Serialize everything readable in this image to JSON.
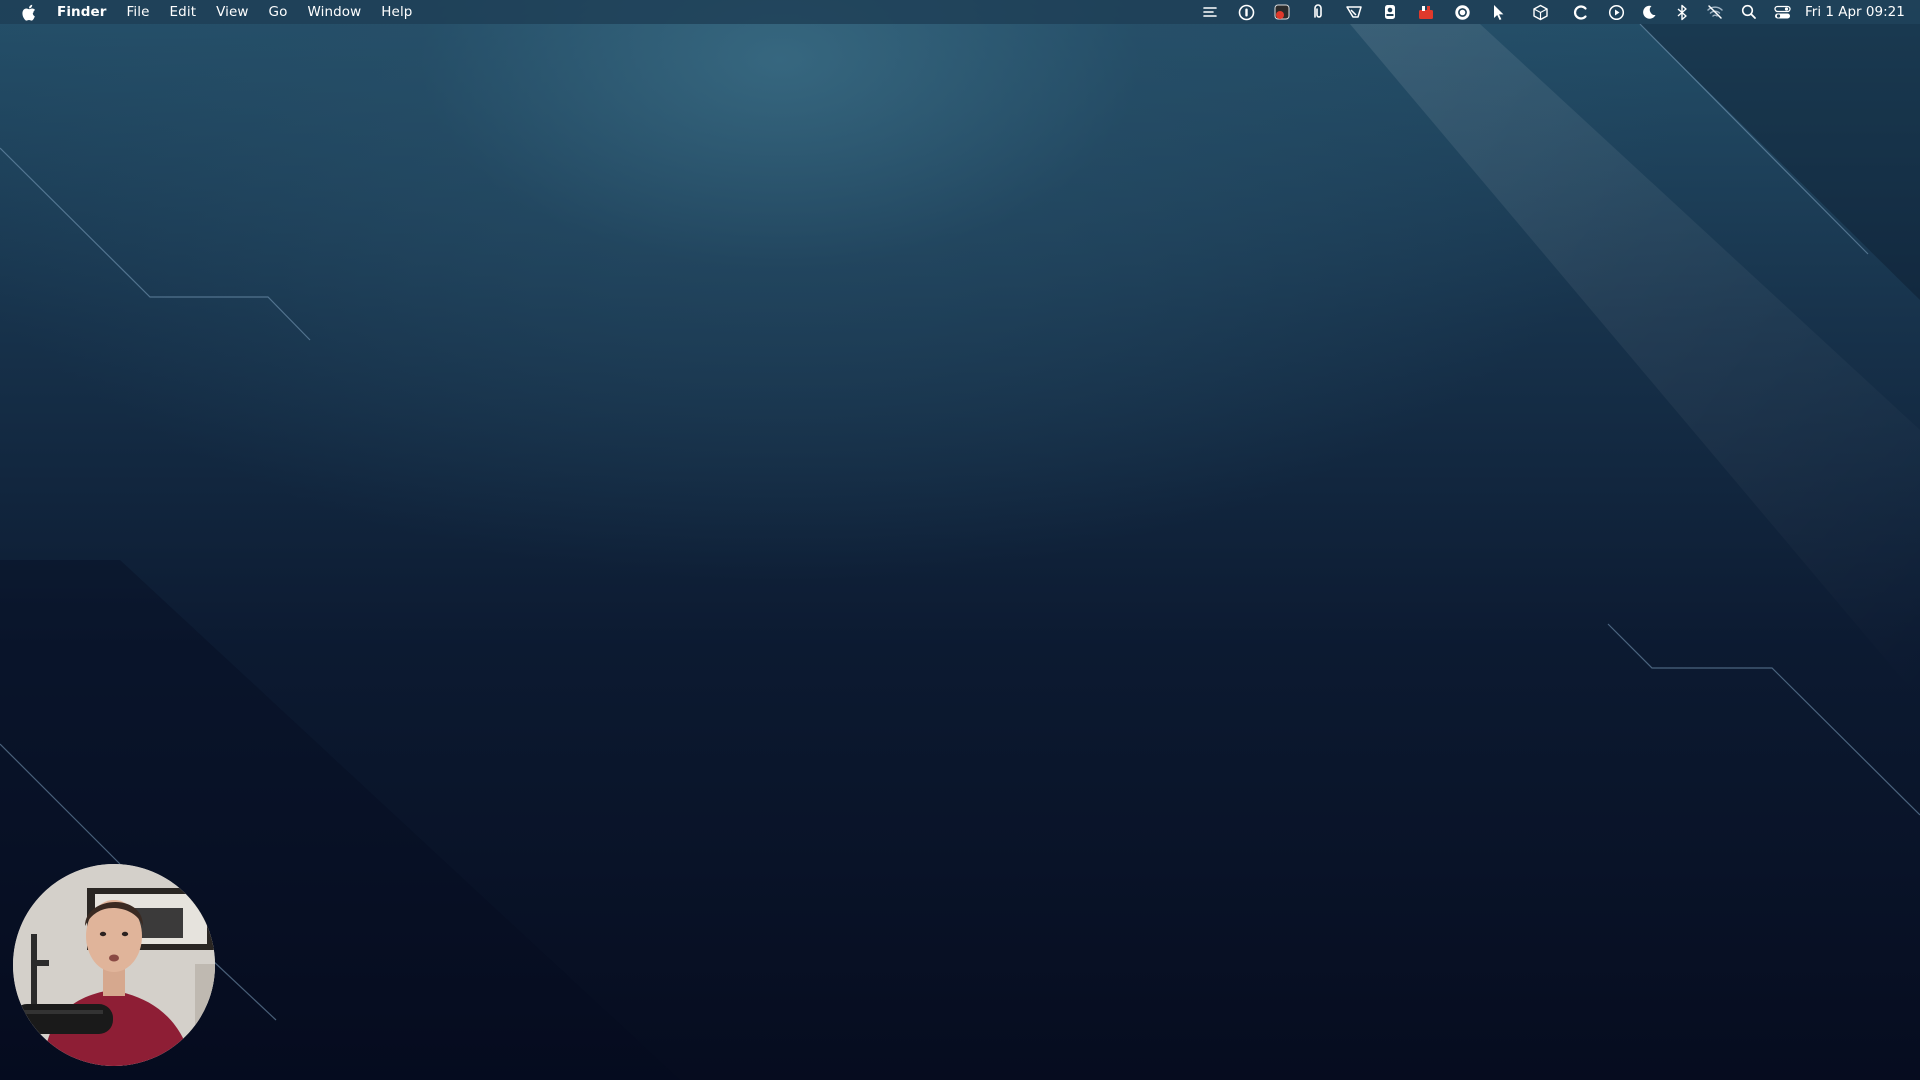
{
  "menubar": {
    "apple_icon": "apple-logo-icon",
    "app_name": "Finder",
    "menus": [
      "File",
      "Edit",
      "View",
      "Go",
      "Window",
      "Help"
    ],
    "status_icons": [
      "text-list-icon",
      "password-manager-icon",
      "notification-badge-app-icon",
      "clipboard-icon",
      "dropzone-icon",
      "webcam-app-icon",
      "red-bookmark-app-icon",
      "target-icon",
      "cursor-icon",
      "cube-icon",
      "refresh-c-icon",
      "play-circle-icon",
      "moon-icon",
      "bluetooth-icon",
      "wifi-off-icon",
      "search-icon",
      "control-center-icon"
    ],
    "clock": "Fri 1 Apr  09:21"
  },
  "webcam": {
    "description_icon": "webcam-overlay"
  },
  "colors": {
    "menubar_bg": "#1e3e54",
    "wallpaper_top": "#24506a",
    "wallpaper_bottom": "#060c1f",
    "badge_red": "#e0392b"
  }
}
